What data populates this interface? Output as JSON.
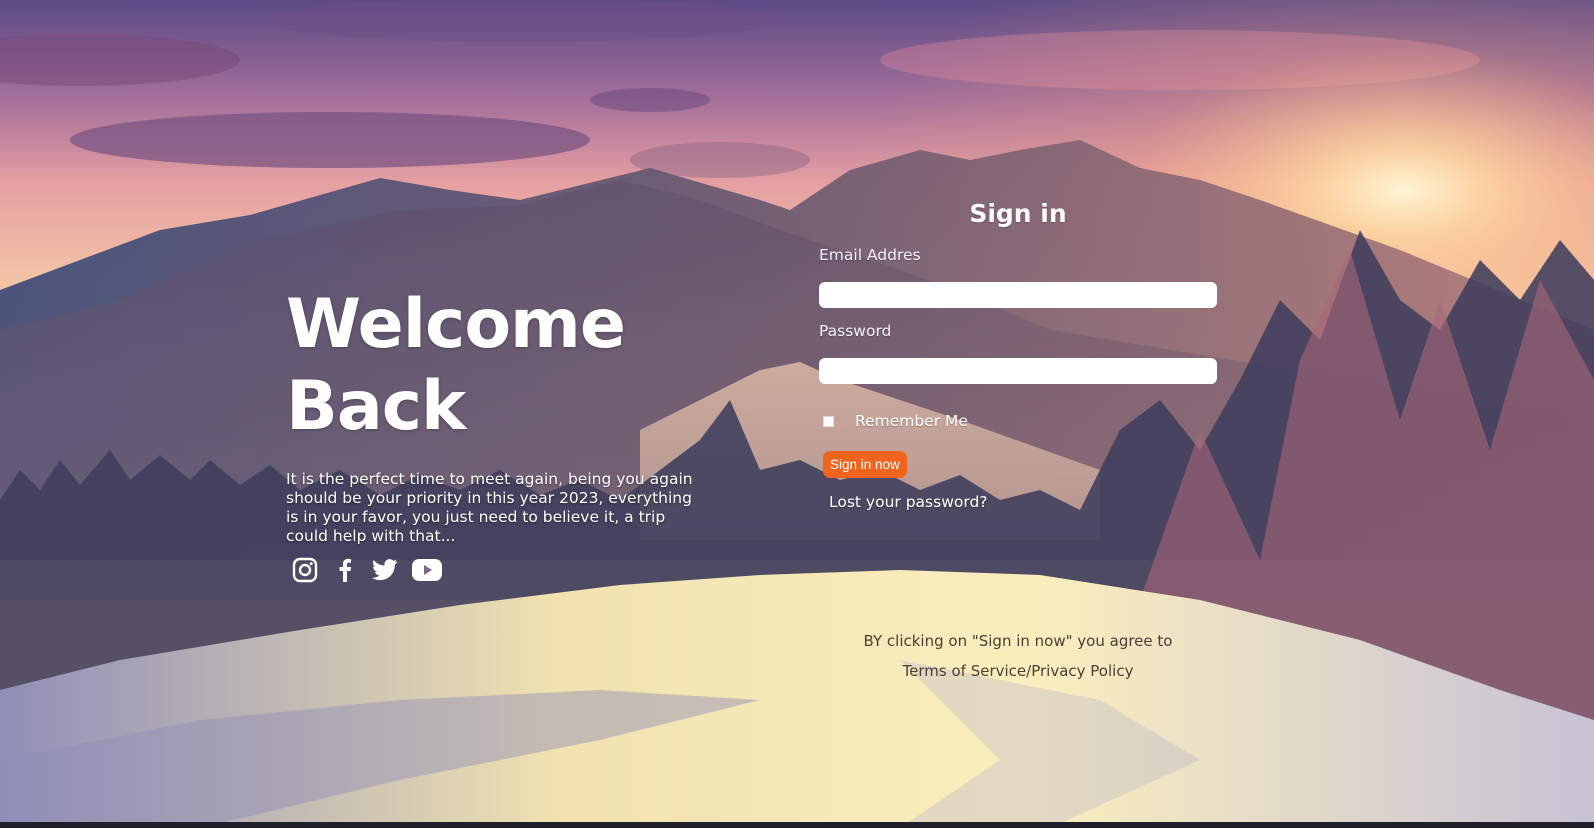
{
  "welcome": {
    "title_line1": "Welcome",
    "title_line2": "Back",
    "description": "It is the perfect time to meet again, being you again should be your priority in this year 2023, everything is in your favor, you just need to believe it, a trip could help with that..."
  },
  "socials": [
    {
      "icon": "instagram-icon"
    },
    {
      "icon": "facebook-icon"
    },
    {
      "icon": "twitter-icon"
    },
    {
      "icon": "youtube-icon"
    }
  ],
  "signin": {
    "title": "Sign in",
    "email_label": "Email Addres",
    "email_value": "",
    "password_label": "Password",
    "password_value": "",
    "remember_label": "Remember Me",
    "remember_checked": false,
    "button_label": "Sign in now",
    "lost_password": "Lost your password?"
  },
  "terms": {
    "prefix": "BY clicking on \"Sign in now\" you agree to",
    "tos": "Terms of Service",
    "separator": "/",
    "privacy": "Privacy Policy"
  },
  "colors": {
    "button": "#f0641e",
    "terms_text": "#4c3d35"
  }
}
